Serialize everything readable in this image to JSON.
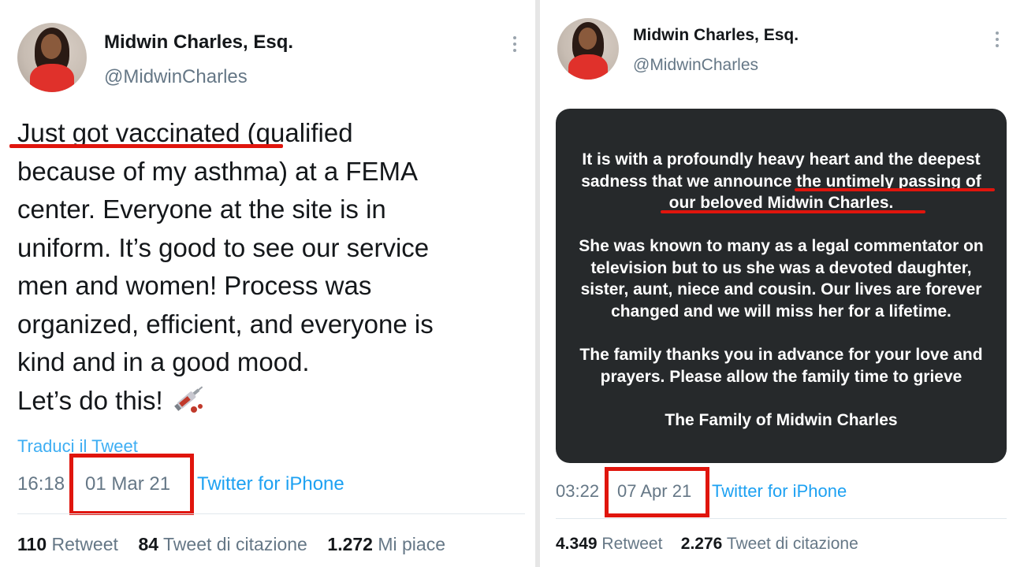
{
  "left_tweet": {
    "author_name": "Midwin Charles, Esq.",
    "handle": "@MidwinCharles",
    "text_highlight": "Just got vaccinated",
    "text_rest": " (qualified\nbecause of my asthma) at a FEMA\ncenter. Everyone at the site is in\nuniform. It’s good to see our service\nmen and women! Process was\norganized, efficient, and everyone is\nkind and in a good mood.\nLet’s do this! ",
    "emoji_icon": "syringe-icon",
    "translate_link": "Traduci il Tweet",
    "time": "16:18",
    "date": "01 Mar 21",
    "source": "Twitter for iPhone",
    "retweets_count": "110",
    "retweets_label": "Retweet",
    "quotes_count": "84",
    "quotes_label": "Tweet di citazione",
    "likes_count": "1.272",
    "likes_label": "Mi piace"
  },
  "right_tweet": {
    "author_name": "Midwin Charles, Esq.",
    "handle": "@MidwinCharles",
    "card_paragraph_1": "It is with a profoundly heavy heart and the deepest\nsadness that we announce the untimely passing of\nour beloved Midwin Charles.",
    "card_paragraph_2": "She was known to many as a legal commentator on\ntelevision but to us she was a devoted daughter,\nsister, aunt, niece and cousin. Our lives are forever\nchanged and we will miss her for a lifetime.",
    "card_paragraph_3": "The family thanks you in advance for your love and\nprayers. Please allow the family time to grieve",
    "card_signature": "The Family of Midwin Charles",
    "time": "03:22",
    "date": "07 Apr 21",
    "source": "Twitter for iPhone",
    "retweets_count": "4.349",
    "retweets_label": "Retweet",
    "quotes_count": "2.276",
    "quotes_label": "Tweet di citazione"
  },
  "colors": {
    "highlight_red": "#e0150d",
    "link_blue": "#1da1f2",
    "card_bg": "#26292b"
  }
}
